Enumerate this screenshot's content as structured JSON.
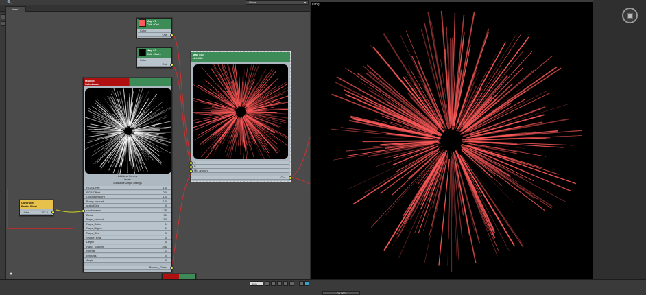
{
  "topbar": {
    "views_dropdown": "Views",
    "tab": "View1"
  },
  "viewport": {
    "label": "Dmg"
  },
  "nodes": {
    "map87": {
      "title": "Map #7",
      "subtitle": "Chk : Col...",
      "row": "Color",
      "port_out": "Out"
    },
    "map82": {
      "title": "Map #2",
      "subtitle": "Chk : Col...",
      "row": "Color",
      "port_out": "Out"
    },
    "map50": {
      "title": "Map #50",
      "subtitle": "ckt: Mix",
      "rows": [
        "A",
        "B",
        "Mix amount"
      ],
      "port_out": "Out"
    },
    "main": {
      "title": "Map #5",
      "subtitle": "Substance",
      "section1": "Additional Params",
      "section2": "Levels",
      "section3": "Substance Output Settings",
      "params": [
        {
          "name": "RGB Level",
          "value": "1.0"
        },
        {
          "name": "RGB Offset",
          "value": "0.0"
        },
        {
          "name": "Output Amount",
          "value": "1.0"
        },
        {
          "name": "Bump Amount",
          "value": "1.0"
        },
        {
          "name": "outputSize",
          "value": "0"
        },
        {
          "name": "randomseed",
          "value": "128"
        },
        {
          "name": "Detail",
          "value": "30"
        },
        {
          "name": "Rays_amount",
          "value": "50"
        },
        {
          "name": "Rays_Color",
          "value": "1"
        },
        {
          "name": "Rays_Bigger",
          "value": "1"
        },
        {
          "name": "Rays_Size",
          "value": "0"
        },
        {
          "name": "Shape_Rnd",
          "value": "0"
        },
        {
          "name": "Depth",
          "value": "0"
        },
        {
          "name": "Rand_Spacing",
          "value": "256"
        },
        {
          "name": "Normal",
          "value": "1"
        },
        {
          "name": "Emboss",
          "value": "0"
        },
        {
          "name": "Angle",
          "value": "0"
        }
      ],
      "port_out": "Broken_Glass"
    },
    "controller": {
      "title": "Controller",
      "subtitle": "Bezier Float",
      "row_label": "Value",
      "row_value": "127.0"
    }
  },
  "bottombar": {
    "zoom": "95%",
    "frame": "0 / 100"
  },
  "colors": {
    "node_green": "#3d8b57",
    "node_red": "#b01010",
    "wire_red": "#d03030",
    "port_yellow": "#e9ff2c",
    "burst": "#ff5a5a"
  }
}
